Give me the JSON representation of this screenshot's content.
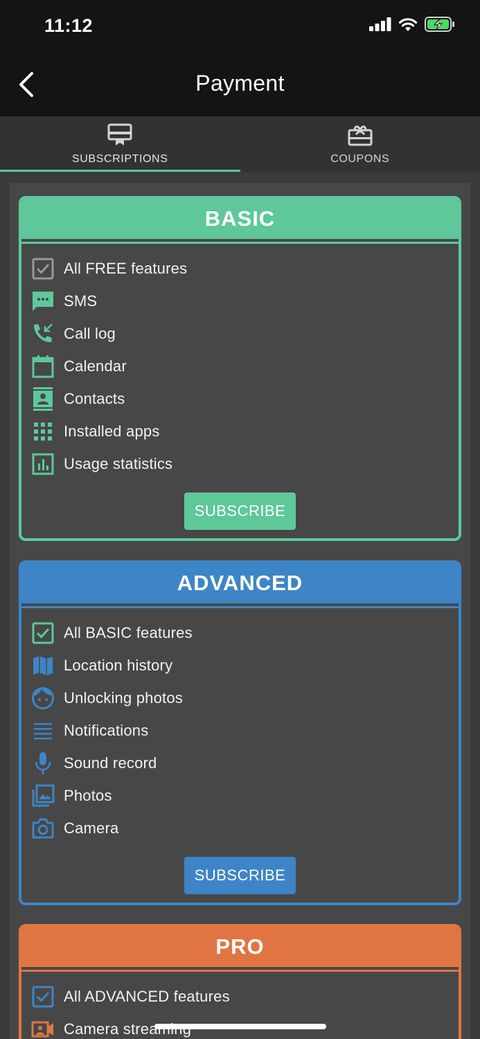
{
  "status": {
    "time": "11:12"
  },
  "nav": {
    "title": "Payment"
  },
  "tabs": [
    {
      "label": "SUBSCRIPTIONS",
      "icon": "subscriptions-icon",
      "active": true
    },
    {
      "label": "COUPONS",
      "icon": "coupons-icon",
      "active": false
    }
  ],
  "colors": {
    "basic": "#5ec89a",
    "advanced": "#3d85c6",
    "pro": "#e07543"
  },
  "plans": {
    "basic": {
      "title": "BASIC",
      "subscribe_label": "SUBSCRIBE",
      "features": [
        {
          "label": "All FREE features",
          "icon": "checkbox-icon"
        },
        {
          "label": "SMS",
          "icon": "sms-icon"
        },
        {
          "label": "Call log",
          "icon": "call-log-icon"
        },
        {
          "label": "Calendar",
          "icon": "calendar-icon"
        },
        {
          "label": "Contacts",
          "icon": "contacts-icon"
        },
        {
          "label": "Installed apps",
          "icon": "apps-grid-icon"
        },
        {
          "label": "Usage statistics",
          "icon": "bar-chart-icon"
        }
      ]
    },
    "advanced": {
      "title": "ADVANCED",
      "subscribe_label": "SUBSCRIBE",
      "features": [
        {
          "label": "All BASIC features",
          "icon": "checkbox-icon"
        },
        {
          "label": "Location history",
          "icon": "map-icon"
        },
        {
          "label": "Unlocking photos",
          "icon": "face-icon"
        },
        {
          "label": "Notifications",
          "icon": "notifications-list-icon"
        },
        {
          "label": "Sound record",
          "icon": "microphone-icon"
        },
        {
          "label": "Photos",
          "icon": "photo-library-icon"
        },
        {
          "label": "Camera",
          "icon": "camera-icon"
        }
      ]
    },
    "pro": {
      "title": "PRO",
      "features": [
        {
          "label": "All ADVANCED features",
          "icon": "checkbox-icon"
        },
        {
          "label": "Camera streaming",
          "icon": "video-camera-icon"
        }
      ]
    }
  }
}
